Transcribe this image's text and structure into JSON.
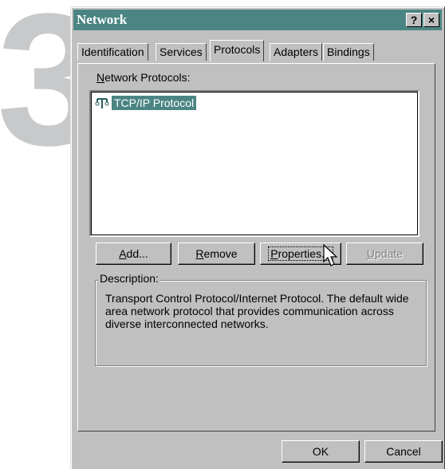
{
  "step_number": "3",
  "window": {
    "title": "Network",
    "help_glyph": "?",
    "close_glyph": "×"
  },
  "tabs": [
    {
      "label": "Identification",
      "active": false
    },
    {
      "label": "Services",
      "active": false
    },
    {
      "label": "Protocols",
      "active": true
    },
    {
      "label": "Adapters",
      "active": false
    },
    {
      "label": "Bindings",
      "active": false
    }
  ],
  "protocols": {
    "label_mnemonic": "N",
    "label_rest": "etwork Protocols:",
    "items": [
      {
        "label": "TCP/IP Protocol",
        "icon": "network-protocol-icon",
        "selected": true
      }
    ]
  },
  "buttons": {
    "add": {
      "mnemonic": "A",
      "rest": "dd..."
    },
    "remove": {
      "mnemonic": "R",
      "rest": "emove"
    },
    "properties": {
      "mnemonic": "P",
      "rest": "roperties..."
    },
    "update": {
      "mnemonic": "U",
      "rest": "pdate",
      "disabled": true
    }
  },
  "description": {
    "label": "Description:",
    "text": "Transport Control Protocol/Internet Protocol. The default wide area network protocol that provides communication across diverse interconnected networks."
  },
  "footer": {
    "ok": "OK",
    "cancel": "Cancel"
  },
  "colors": {
    "titlebar": "#4b8583",
    "face": "#c0c0c0",
    "selection": "#4b8583",
    "step_number": "#c7c9cb"
  }
}
